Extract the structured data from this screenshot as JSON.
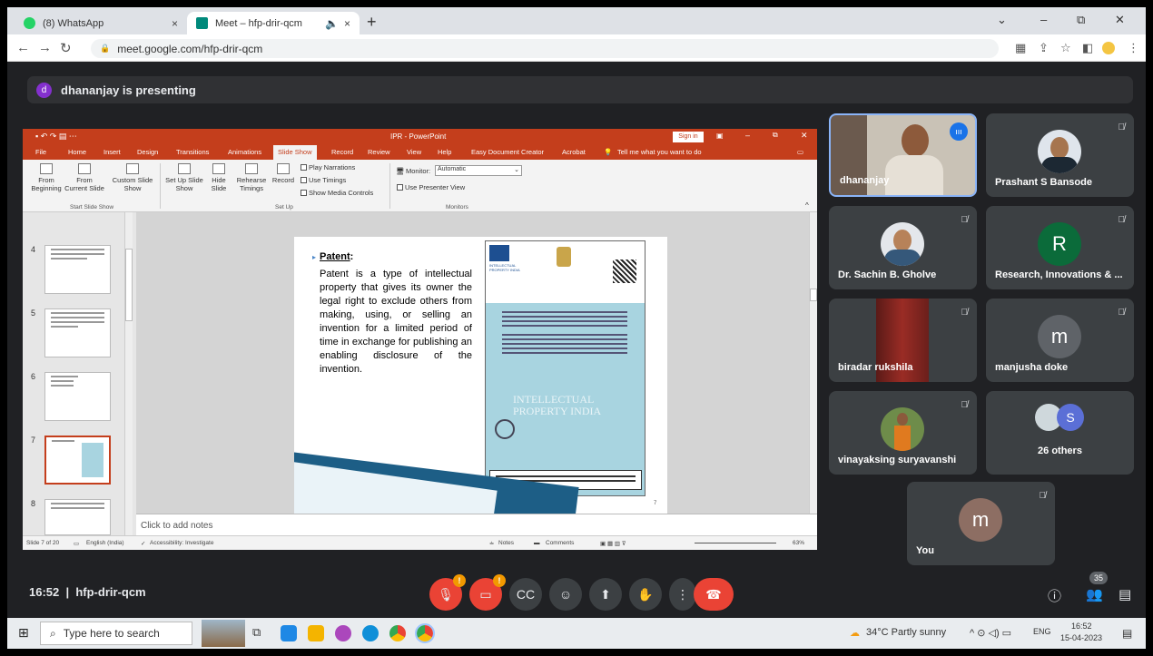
{
  "browser": {
    "tabs": [
      {
        "label": "(8) WhatsApp",
        "active": false
      },
      {
        "label": "Meet – hfp-drir-qcm",
        "active": true
      }
    ],
    "close_glyph": "×",
    "new_tab_glyph": "+",
    "url": "meet.google.com/hfp-drir-qcm",
    "window_controls": [
      "⌄",
      "–",
      "⧉",
      "✕"
    ]
  },
  "meet": {
    "presenting_initial": "d",
    "presenting_text": "dhananjay is presenting",
    "meeting_time": "16:52",
    "meeting_code": "hfp-drir-qcm",
    "participants_count": "35",
    "others_label": "26 others",
    "others_initial": "S",
    "tiles": [
      {
        "name": "dhananjay",
        "kind": "video"
      },
      {
        "name": "Prashant S Bansode",
        "kind": "photo"
      },
      {
        "name": "Dr. Sachin B. Gholve",
        "kind": "photo"
      },
      {
        "name": "Research, Innovations & ...",
        "kind": "letter",
        "initial": "R",
        "color": "#0b6b3a"
      },
      {
        "name": "biradar rukshila",
        "kind": "video"
      },
      {
        "name": "manjusha doke",
        "kind": "letter",
        "initial": "m",
        "color": "#5f6368"
      },
      {
        "name": "vinayaksing suryavanshi",
        "kind": "photo"
      },
      {
        "name": "You",
        "kind": "letter",
        "initial": "m",
        "color": "#8d6e63"
      }
    ]
  },
  "ppt": {
    "title": "IPR - PowerPoint",
    "sign_in": "Sign in",
    "tabs": [
      "File",
      "Home",
      "Insert",
      "Design",
      "Transitions",
      "Animations",
      "Slide Show",
      "Record",
      "Review",
      "View",
      "Help",
      "Easy Document Creator",
      "Acrobat"
    ],
    "active_tab": "Slide Show",
    "tell_me": "Tell me what you want to do",
    "ribbon": {
      "from_beginning": "From Beginning",
      "from_current": "From Current Slide",
      "custom_show": "Custom Slide Show",
      "setup_show": "Set Up Slide Show",
      "hide_slide": "Hide Slide",
      "rehearse": "Rehearse Timings",
      "record": "Record",
      "play_narrations": "Play Narrations",
      "use_timings": "Use Timings",
      "show_media": "Show Media Controls",
      "monitor_label": "Monitor:",
      "monitor_value": "Automatic",
      "presenter_view": "Use Presenter View",
      "group_start": "Start Slide Show",
      "group_setup": "Set Up",
      "group_monitors": "Monitors"
    },
    "thumbnails": [
      "4",
      "5",
      "6",
      "7",
      "8"
    ],
    "selected_slide": "7",
    "slide": {
      "heading": "Patent",
      "heading_colon": ":",
      "body": "Patent is a type of intellectual property that gives its owner the legal right to exclude others from making, using, or selling an invention for a limited period of time in exchange for publishing an enabling disclosure of the invention.",
      "cert_brand": "INTELLECTUAL PROPERTY INDIA",
      "cert_watermark": "INTELLECTUAL PROPERTY INDIA",
      "page_number": "7"
    },
    "notes_placeholder": "Click to add notes",
    "status": {
      "slide_count": "Slide 7 of 20",
      "language": "English (India)",
      "accessibility": "Accessibility: Investigate",
      "notes": "Notes",
      "comments": "Comments",
      "zoom": "63%"
    }
  },
  "taskbar": {
    "search_placeholder": "Type here to search",
    "weather": "34°C Partly sunny",
    "lang": "ENG",
    "time": "16:52",
    "date": "15-04-2023"
  }
}
